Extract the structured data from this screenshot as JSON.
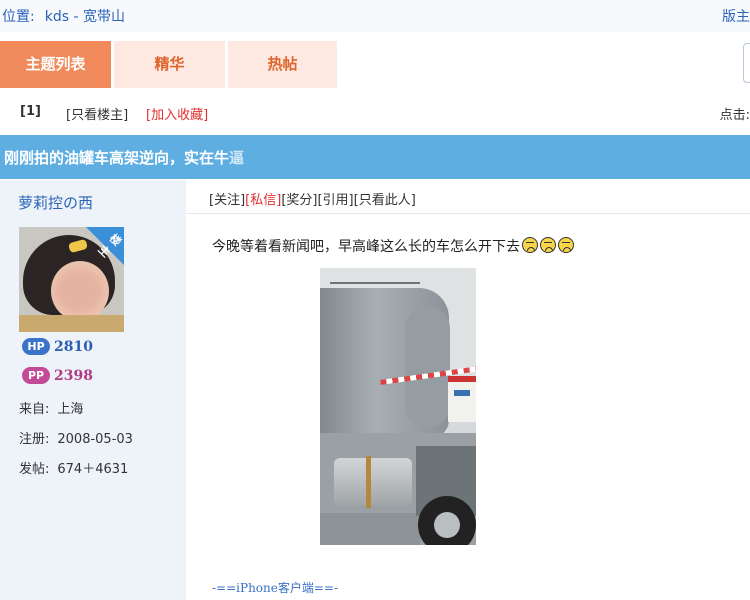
{
  "breadcrumb": {
    "label": "位置:",
    "board": "kds - 宽带山",
    "right_link": "版主"
  },
  "tabs": [
    {
      "label": "主题列表",
      "active": true
    },
    {
      "label": "精华",
      "active": false
    },
    {
      "label": "热帖",
      "active": false
    }
  ],
  "pager": {
    "page": "[1]",
    "only_op": "[只看楼主]",
    "add_favorite": "[加入收藏]",
    "clicks_label": "点击:"
  },
  "thread": {
    "title": "刚刚拍的油罐车高架逆向，实在牛",
    "title_faded": "逼"
  },
  "user": {
    "name": "萝莉控の西",
    "badge": "楼主",
    "hp_label": "HP",
    "hp": "2810",
    "pp_label": "PP",
    "pp": "2398",
    "from_label": "来自:",
    "from": "上海",
    "register_label": "注册:",
    "register": "2008-05-03",
    "posts_label": "发帖:",
    "posts": "674＋4631"
  },
  "post": {
    "actions": {
      "follow": "[关注]",
      "message": "[私信]",
      "reward": "[奖分]",
      "quote": "[引用]",
      "only_this": "[只看此人]"
    },
    "text": "今晚等着看新闻吧，早高峰这么长的车怎么开下去",
    "emoticon_count": 3,
    "image_alt": "油罐车照片",
    "source": "-==iPhone客户端==-"
  },
  "colors": {
    "link": "#2a63b8",
    "tab_active": "#f08a5a",
    "tab_inactive": "#fde9e2",
    "title_bar": "#5eaee2",
    "user_panel": "#eef3fa",
    "warning": "#e2302e"
  },
  "icons": [
    "host-badge",
    "hp-pill",
    "pp-pill",
    "emoticon-icon"
  ]
}
